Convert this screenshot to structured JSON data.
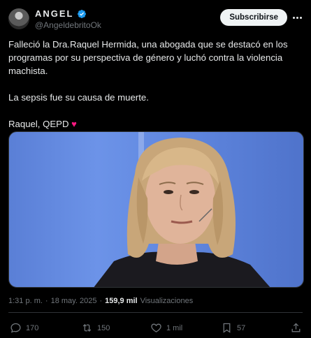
{
  "author": {
    "name": "ANGEL",
    "handle": "@AngeldebritoOk"
  },
  "header": {
    "subscribe_label": "Subscribirse"
  },
  "post": {
    "paragraph1": "Falleció la Dra.Raquel Hermida, una abogada que se destacó en los programas por su perspectiva de  género y luchó contra la violencia machista.",
    "paragraph2": "La sepsis fue su causa de muerte.",
    "paragraph3": "Raquel, QEPD",
    "heart": "♥"
  },
  "meta": {
    "time": "1:31 p. m.",
    "separator": "·",
    "date": "18 may. 2025",
    "separator2": "·",
    "views_count": "159,9 mil",
    "views_label": "Visualizaciones"
  },
  "actions": {
    "replies": "170",
    "reposts": "150",
    "likes": "1 mil",
    "bookmarks": "57"
  },
  "icons": {
    "verified": "verified-badge-icon",
    "more": "more-icon",
    "reply": "reply-icon",
    "repost": "repost-icon",
    "like": "like-icon",
    "bookmark": "bookmark-icon",
    "share": "share-icon"
  },
  "colors": {
    "background": "#000000",
    "verified": "#1d9bf0",
    "heart": "#f91880",
    "secondary_text": "#71767b"
  }
}
